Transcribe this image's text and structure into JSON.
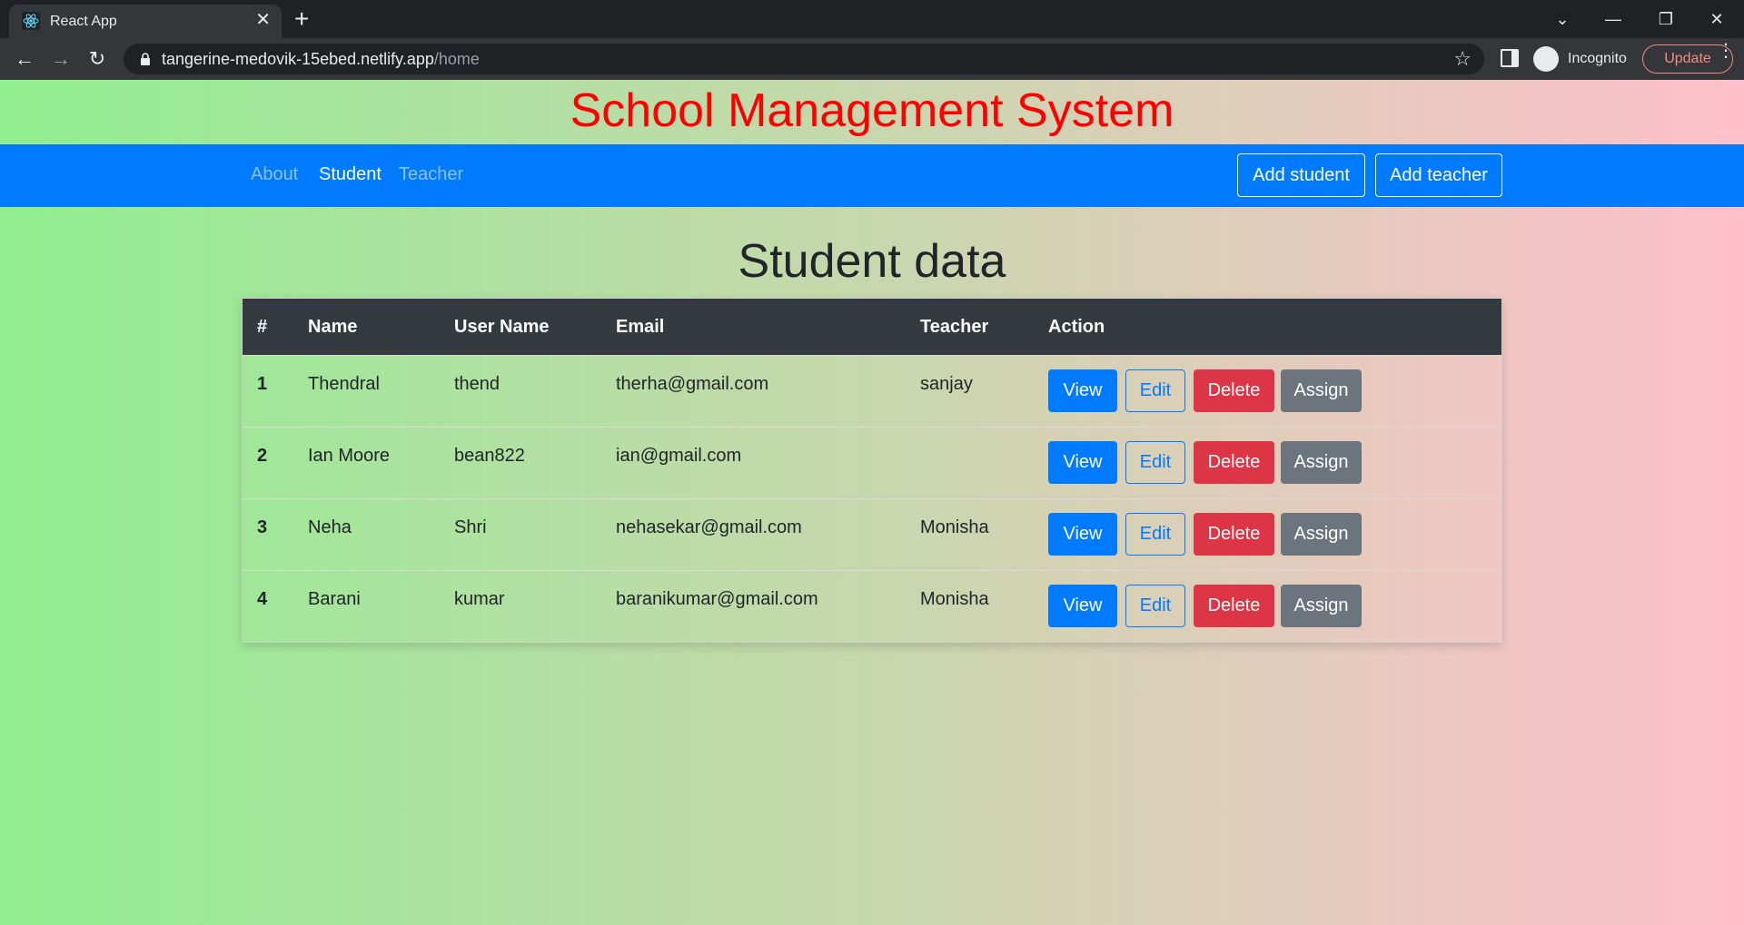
{
  "browser": {
    "tab_title": "React App",
    "url_host": "tangerine-medovik-15ebed.netlify.app",
    "url_path": "/home",
    "incognito_label": "Incognito",
    "update_label": "Update"
  },
  "site": {
    "title": "School Management System",
    "title_color": "#ff0000"
  },
  "navbar": {
    "links": [
      "About",
      "Student",
      "Teacher"
    ],
    "active": "Student",
    "add_student": "Add student",
    "add_teacher": "Add teacher",
    "background": "#007bff"
  },
  "section_title": "Student data",
  "table": {
    "headers": [
      "#",
      "Name",
      "User Name",
      "Email",
      "Teacher",
      "Action"
    ],
    "rows": [
      {
        "num": "1",
        "name": "Thendral",
        "username": "thend",
        "email": "therha@gmail.com",
        "teacher": "sanjay"
      },
      {
        "num": "2",
        "name": "Ian Moore",
        "username": "bean822",
        "email": "ian@gmail.com",
        "teacher": ""
      },
      {
        "num": "3",
        "name": "Neha",
        "username": "Shri",
        "email": "nehasekar@gmail.com",
        "teacher": "Monisha"
      },
      {
        "num": "4",
        "name": "Barani",
        "username": "kumar",
        "email": "baranikumar@gmail.com",
        "teacher": "Monisha"
      }
    ],
    "actions": {
      "view": "View",
      "edit": "Edit",
      "delete": "Delete",
      "assign": "Assign"
    }
  }
}
